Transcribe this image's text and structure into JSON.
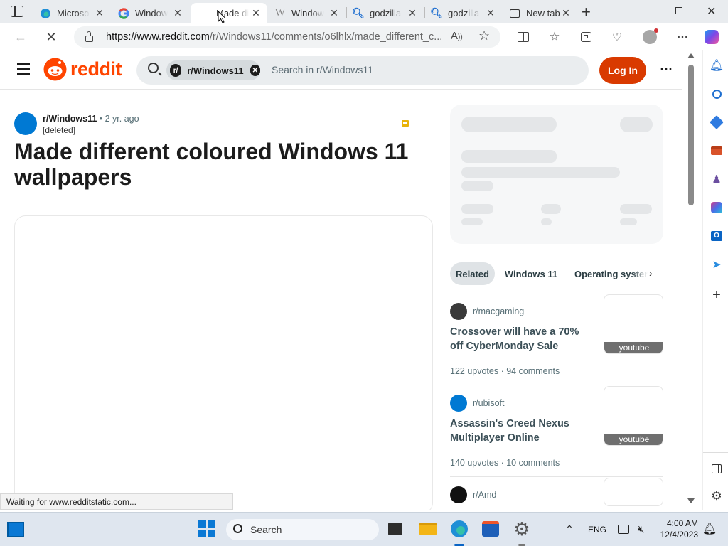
{
  "browser": {
    "tabs": [
      {
        "title": "Microsoft",
        "icon": "edge-icon"
      },
      {
        "title": "Windows",
        "icon": "google-icon"
      },
      {
        "title": "Made di",
        "icon": "none",
        "active": true
      },
      {
        "title": "Windows",
        "icon": "wikipedia-icon"
      },
      {
        "title": "godzilla",
        "icon": "search-icon"
      },
      {
        "title": "godzilla",
        "icon": "search-icon"
      },
      {
        "title": "New tab",
        "icon": "newtab-icon"
      }
    ],
    "url_host": "https://www.reddit.com",
    "url_path": "/r/Windows11/comments/o6lhlx/made_different_c..."
  },
  "reddit": {
    "logo_text": "reddit",
    "search_chip": "r/Windows11",
    "search_placeholder": "Search in r/Windows11",
    "login_label": "Log In"
  },
  "post": {
    "subreddit": "r/Windows11",
    "time": "• 2 yr. ago",
    "author": "[deleted]",
    "title": "Made different coloured Windows 11 wallpapers"
  },
  "related": {
    "tabs": [
      "Related",
      "Windows 11",
      "Operating system"
    ],
    "items": [
      {
        "sub": "r/macgaming",
        "title": "Crossover will have a 70% off CyberMonday Sale",
        "meta": "122 upvotes · 94 comments",
        "thumb": "youtube",
        "avatar_color": "#3a3a3a"
      },
      {
        "sub": "r/ubisoft",
        "title": "Assassin's Creed Nexus Multiplayer Online",
        "meta": "140 upvotes · 10 comments",
        "thumb": "youtube",
        "avatar_color": "#0079d3"
      },
      {
        "sub": "r/Amd",
        "title": "",
        "meta": "",
        "thumb": "",
        "avatar_color": "#111111"
      }
    ]
  },
  "status_text": "Waiting for www.redditstatic.com...",
  "taskbar": {
    "search_label": "Search",
    "lang": "ENG",
    "time": "4:00 AM",
    "date": "12/4/2023"
  },
  "colors": {
    "reddit_orange": "#ff4500",
    "login_button": "#d93a00",
    "avatar_blue": "#0079d3"
  }
}
